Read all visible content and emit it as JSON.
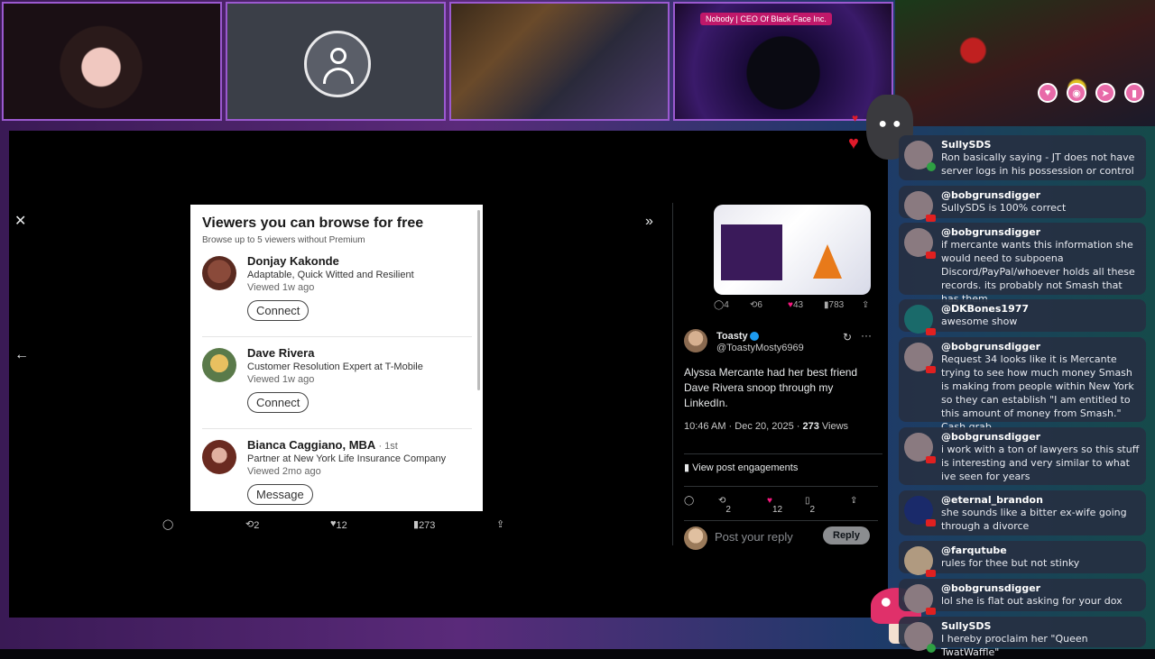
{
  "stream_tag": "Nobody | CEO Of Black Face Inc.",
  "colors": {
    "accent": "#9b59d0",
    "chat_bg": "#263042",
    "like": "#f91880",
    "verified": "#1d9bf0"
  },
  "viewer": {
    "close_icon": "close-icon",
    "back_icon": "arrow-left-icon",
    "expand_icon": "double-chevron-right-icon"
  },
  "linkedin_card": {
    "title": "Viewers you can browse for free",
    "subtitle": "Browse up to 5 viewers without Premium",
    "viewers": [
      {
        "name": "Donjay Kakonde",
        "degree": "",
        "headline": "Adaptable, Quick Witted and Resilient",
        "viewed": "Viewed 1w ago",
        "action": "Connect"
      },
      {
        "name": "Dave Rivera",
        "degree": "",
        "headline": "Customer Resolution Expert at T-Mobile",
        "viewed": "Viewed 1w ago",
        "action": "Connect"
      },
      {
        "name": "Bianca Caggiano, MBA",
        "degree": "· 1st",
        "headline": "Partner at New York Life Insurance Company",
        "viewed": "Viewed 2mo ago",
        "action": "Message"
      }
    ]
  },
  "media_actions": {
    "retweets": "2",
    "likes": "12",
    "views": "273"
  },
  "quoted_stats": {
    "replies": "4",
    "retweets": "6",
    "likes": "43",
    "views": "783"
  },
  "tweet": {
    "author_name": "Toasty",
    "author_handle": "@ToastyMosty6969",
    "text": "Alyssa Mercante had her best friend Dave Rivera snoop through my LinkedIn.",
    "time": "10:46 AM · Dec 20, 2025 · ",
    "views_count": "273",
    "views_label": " Views",
    "engagements_label": "View post engagements",
    "retweets": "2",
    "likes": "12",
    "bookmarks": "2",
    "reply_placeholder": "Post your reply",
    "reply_button": "Reply"
  },
  "chat": [
    {
      "user": "SullySDS",
      "text": "Ron basically saying - JT does not have server logs in his possession or control",
      "platform": "twitch"
    },
    {
      "user": "@bobgrunsdigger",
      "text": "SullySDS is 100% correct",
      "platform": "youtube"
    },
    {
      "user": "@bobgrunsdigger",
      "text": "if mercante wants this information she would need to subpoena Discord/PayPal/whoever holds all these records. its probably not Smash that has them",
      "platform": "youtube"
    },
    {
      "user": "@DKBones1977",
      "text": "awesome show",
      "platform": "youtube"
    },
    {
      "user": "@bobgrunsdigger",
      "text": "Request 34 looks like it is Mercante trying to see how much money Smash is making from people within New York so they can establish \"I am entitled to this amount of money from Smash.\" Cash grab",
      "platform": "youtube"
    },
    {
      "user": "@bobgrunsdigger",
      "text": "i work with a ton of lawyers so this stuff is interesting and very similar to what ive seen for years",
      "platform": "youtube"
    },
    {
      "user": "@eternal_brandon",
      "text": "she sounds like a bitter ex-wife going through a divorce",
      "platform": "youtube"
    },
    {
      "user": "@farqutube",
      "text": "rules for thee but not stinky",
      "platform": "youtube"
    },
    {
      "user": "@bobgrunsdigger",
      "text": "lol she is flat out asking for your dox",
      "platform": "youtube"
    },
    {
      "user": "SullySDS",
      "text": "I hereby proclaim her \"Queen TwatWaffle\"",
      "platform": "twitch"
    }
  ]
}
